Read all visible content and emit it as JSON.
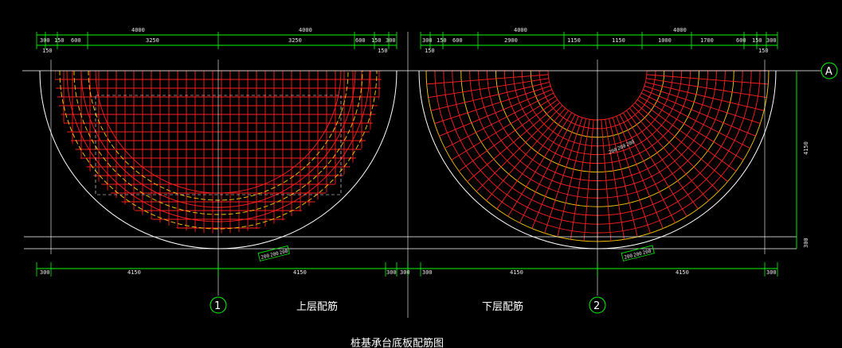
{
  "drawing": {
    "colors": {
      "background": "#000000",
      "dimension": "#00ff00",
      "rebar": "#ff2020",
      "outline": "#ffffff",
      "ring": "#ffcc00"
    },
    "top_dims_left": {
      "overall": [
        "4000",
        "4000"
      ],
      "segments": [
        "300",
        "150",
        "600",
        "3250",
        "3250",
        "600",
        "150",
        "300"
      ],
      "sub": [
        "150",
        "150"
      ]
    },
    "top_dims_right": {
      "overall": [
        "4000",
        "4000"
      ],
      "segments": [
        "300",
        "150",
        "600",
        "2900",
        "1150",
        "1150",
        "1000",
        "1700",
        "600",
        "150",
        "300"
      ],
      "sub": [
        "150",
        "150"
      ]
    },
    "side_dims": [
      "4150",
      "300"
    ],
    "bottom_dims_left": [
      "300",
      "4150",
      "4150",
      "300",
      "300"
    ],
    "bottom_dims_right": [
      "300",
      "4150",
      "4150",
      "300"
    ],
    "bottom_small_dims": [
      "200",
      "200",
      "200"
    ],
    "inner_small_dims": [
      "200",
      "200",
      "200"
    ],
    "axes": {
      "circle_1": "1",
      "circle_2": "2",
      "circle_a": "A"
    },
    "labels": {
      "top_layer": "上层配筋",
      "bottom_layer": "下层配筋",
      "footer": "桩基承台底板配筋图"
    }
  }
}
